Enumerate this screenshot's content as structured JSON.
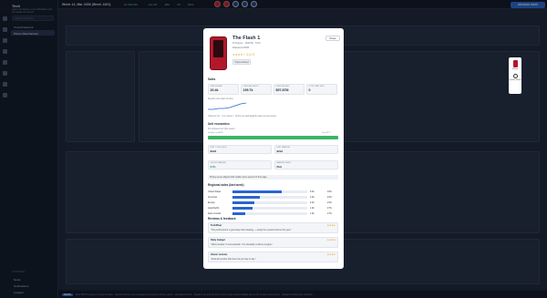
{
  "sidebar": {
    "brand": "Tech",
    "subtitle": "Agent the fastest, most affordable mid-tier equipment sector",
    "search_placeholder": "Search industries...",
    "items": [
      {
        "label": "Overall Network"
      },
      {
        "label": "Phone Manufacturer"
      }
    ],
    "section": "ACTIVITIES",
    "bottom_items": [
      {
        "label": "News"
      },
      {
        "label": "Notifications"
      },
      {
        "label": "Ledgers"
      }
    ]
  },
  "topbar": {
    "week": "Week 12, Mar 2006 (Week 1261)",
    "stats": [
      "$1,666,896",
      "+$1.4M",
      "-$80",
      "4%",
      "$921"
    ],
    "advance": "Advance week"
  },
  "ticker": {
    "badge": "NEWS",
    "text": "New PROTO gains on buyers index · Report finance and management looking industry parts · specialized firms · Regal Corp and Synchro Ltd in a fare about holding raw for fin of parts out income · Gadget Smartphone rebuilds..."
  },
  "modal": {
    "title": "The Flash 1",
    "maker": "Prototype · 2MATE · Tech",
    "released": "Released 2006",
    "rating": "★★★★☆ 3.4 / 5",
    "tag": "Highest-Rated",
    "close": "Close",
    "sales_heading": "Sales",
    "stats": [
      {
        "label": "UNITS/WEEK",
        "value": "20.4k"
      },
      {
        "label": "LIFETIME UNITS",
        "value": "199.7k"
      },
      {
        "label": "LIFETIME REV",
        "value": "$57.87M"
      },
      {
        "label": "COST PAID (WK)",
        "value": "0"
      }
    ],
    "weekly_label": "Weekly units (last 12 wks)",
    "channel_note": "Channel mix · 3 on-carrier · Online & retail flagship sales at new speed",
    "unit_heading": "Unit economics",
    "unit_sub": "Per shipped unit (this week)",
    "bar_left": "Variable cost $238",
    "bar_right": "Price $777",
    "cells": [
      {
        "label": "UNIT COGS (EST)",
        "value": "$304",
        "green": false
      },
      {
        "label": "UNIT MARGIN",
        "value": "$291",
        "green": false
      },
      {
        "label": "GROSS MARGIN",
        "value": "64%",
        "green": true
      },
      {
        "label": "MARGIN DRIFT",
        "value": "Flat",
        "green": false
      }
    ],
    "pricing_note": "Pricing never aligned with retailer price-expect for this sage.",
    "regional_heading": "Regional sales (last week)",
    "regions": [
      {
        "name": "United States",
        "value": "5.3k",
        "pct": "19%",
        "share": 0.66
      },
      {
        "name": "Americas",
        "value": "2.9k",
        "pct": "21%",
        "share": 0.36
      },
      {
        "name": "Europe",
        "value": "2.3k",
        "pct": "21%",
        "share": 0.29
      },
      {
        "name": "Asia-Pacific",
        "value": "1.9k",
        "pct": "17%",
        "share": 0.27
      },
      {
        "name": "Rest of world",
        "value": "1.5k",
        "pct": "17%",
        "share": 0.17
      }
    ],
    "reviews_heading": "Reviews & feedback",
    "reviews": [
      {
        "name": "TechRiver",
        "stars": "★★★★",
        "quote": "\"The performance is genuinely class-leading — easily the smartest phone this year.\""
      },
      {
        "name": "Daily Gadget",
        "stars": "★★★★",
        "quote": "\"Well-rounded, if unremarkable. The durability could be tougher.\""
      },
      {
        "name": "Owner reviews",
        "stars": "★★★★",
        "quote": "\"Solid all-rounder that does the job day to day.\""
      }
    ]
  },
  "side_panel": {
    "item1": "Phone",
    "item2": "Launch Flash"
  }
}
